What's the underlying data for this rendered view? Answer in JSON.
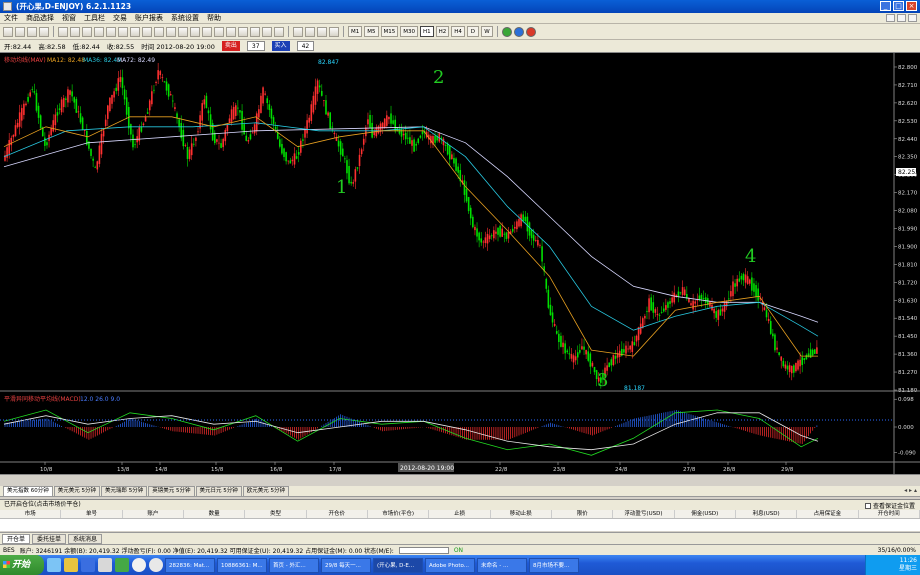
{
  "window": {
    "title": "(开心果,D-ENJOY) 6.2.1.1123"
  },
  "menu": [
    "文件",
    "商品选择",
    "视窗",
    "工具栏",
    "交易",
    "账户报表",
    "系统设置",
    "帮助"
  ],
  "toolbar": {
    "timeframes": [
      "M1",
      "M5",
      "M15",
      "M30",
      "H1",
      "H2",
      "H4",
      "D",
      "W"
    ],
    "active_timeframe": "H1"
  },
  "quote": {
    "open": "开:82.44",
    "high": "高:82.58",
    "low": "低:82.44",
    "close": "收:82.55",
    "time": "时间 2012-08-20 19:00",
    "sell_label": "卖出",
    "sell_price": "37",
    "buy_label": "买入",
    "buy_price": "42"
  },
  "chart_data": {
    "type": "candlestick",
    "legend": {
      "prefix": "移动均线(MAV)",
      "ma12": "MA12: 82.48",
      "ma36": "MA36: 82.49",
      "ma72": "MA72: 82.49"
    },
    "y_ticks": [
      "82.800",
      "82.710",
      "82.620",
      "82.530",
      "82.440",
      "82.350",
      "82.260",
      "82.170",
      "82.080",
      "81.990",
      "81.900",
      "81.810",
      "81.720",
      "81.630",
      "81.540",
      "81.450",
      "81.360",
      "81.270",
      "81.180"
    ],
    "ylim": [
      81.18,
      82.82
    ],
    "current_price": "82.253",
    "high_label": "82.847",
    "low_label": "81.187",
    "x_ticks": [
      "10/8",
      "13/8",
      "14/8",
      "15/8",
      "16/8",
      "17/8",
      "22/8",
      "23/8",
      "24/8",
      "27/8",
      "28/8",
      "29/8"
    ],
    "x_cursor_label": "2012-08-20 19:00",
    "annotations": [
      "1",
      "2",
      "3",
      "4"
    ],
    "path_points": [
      [
        0,
        82.33
      ],
      [
        8,
        82.55
      ],
      [
        14,
        82.7
      ],
      [
        20,
        82.4
      ],
      [
        26,
        82.58
      ],
      [
        32,
        82.68
      ],
      [
        38,
        82.5
      ],
      [
        44,
        82.28
      ],
      [
        50,
        82.6
      ],
      [
        56,
        82.75
      ],
      [
        62,
        82.4
      ],
      [
        68,
        82.55
      ],
      [
        74,
        82.78
      ],
      [
        80,
        82.65
      ],
      [
        84,
        82.5
      ],
      [
        88,
        82.35
      ],
      [
        92,
        82.45
      ],
      [
        96,
        82.65
      ],
      [
        100,
        82.45
      ],
      [
        104,
        82.4
      ],
      [
        108,
        82.55
      ],
      [
        112,
        82.6
      ],
      [
        116,
        82.42
      ],
      [
        120,
        82.5
      ],
      [
        124,
        82.68
      ],
      [
        128,
        82.55
      ],
      [
        132,
        82.4
      ],
      [
        136,
        82.32
      ],
      [
        140,
        82.35
      ],
      [
        146,
        82.55
      ],
      [
        150,
        82.72
      ],
      [
        154,
        82.58
      ],
      [
        158,
        82.45
      ],
      [
        162,
        82.36
      ],
      [
        166,
        82.2
      ],
      [
        170,
        82.35
      ],
      [
        172,
        82.45
      ],
      [
        174,
        82.55
      ],
      [
        176,
        82.46
      ],
      [
        180,
        82.5
      ],
      [
        184,
        82.55
      ],
      [
        188,
        82.48
      ],
      [
        192,
        82.45
      ],
      [
        196,
        82.4
      ],
      [
        200,
        82.48
      ],
      [
        204,
        82.43
      ],
      [
        208,
        82.45
      ],
      [
        212,
        82.38
      ],
      [
        216,
        82.3
      ],
      [
        220,
        82.18
      ],
      [
        224,
        82.0
      ],
      [
        228,
        81.92
      ],
      [
        232,
        81.95
      ],
      [
        236,
        81.98
      ],
      [
        240,
        81.95
      ],
      [
        244,
        82.0
      ],
      [
        248,
        82.05
      ],
      [
        252,
        81.95
      ],
      [
        256,
        81.9
      ],
      [
        260,
        81.6
      ],
      [
        264,
        81.45
      ],
      [
        268,
        81.38
      ],
      [
        272,
        81.33
      ],
      [
        276,
        81.4
      ],
      [
        280,
        81.32
      ],
      [
        284,
        81.22
      ],
      [
        288,
        81.3
      ],
      [
        292,
        81.35
      ],
      [
        296,
        81.38
      ],
      [
        300,
        81.4
      ],
      [
        304,
        81.5
      ],
      [
        308,
        81.62
      ],
      [
        312,
        81.55
      ],
      [
        316,
        81.6
      ],
      [
        320,
        81.65
      ],
      [
        324,
        81.68
      ],
      [
        328,
        81.6
      ],
      [
        332,
        81.65
      ],
      [
        336,
        81.62
      ],
      [
        340,
        81.55
      ],
      [
        344,
        81.6
      ],
      [
        348,
        81.7
      ],
      [
        352,
        81.75
      ],
      [
        356,
        81.72
      ],
      [
        360,
        81.65
      ],
      [
        364,
        81.55
      ],
      [
        368,
        81.4
      ],
      [
        372,
        81.3
      ],
      [
        376,
        81.28
      ],
      [
        380,
        81.32
      ],
      [
        384,
        81.36
      ],
      [
        388,
        81.38
      ]
    ],
    "ma12_points": [
      [
        0,
        82.4
      ],
      [
        20,
        82.5
      ],
      [
        40,
        82.45
      ],
      [
        60,
        82.55
      ],
      [
        80,
        82.55
      ],
      [
        100,
        82.5
      ],
      [
        120,
        82.55
      ],
      [
        140,
        82.4
      ],
      [
        160,
        82.45
      ],
      [
        180,
        82.48
      ],
      [
        200,
        82.48
      ],
      [
        220,
        82.2
      ],
      [
        240,
        81.98
      ],
      [
        260,
        81.75
      ],
      [
        280,
        81.38
      ],
      [
        300,
        81.35
      ],
      [
        320,
        81.58
      ],
      [
        340,
        81.62
      ],
      [
        360,
        81.65
      ],
      [
        380,
        81.35
      ],
      [
        388,
        81.35
      ]
    ],
    "ma36_points": [
      [
        0,
        82.35
      ],
      [
        30,
        82.48
      ],
      [
        60,
        82.5
      ],
      [
        90,
        82.5
      ],
      [
        120,
        82.52
      ],
      [
        150,
        82.48
      ],
      [
        180,
        82.48
      ],
      [
        200,
        82.5
      ],
      [
        220,
        82.35
      ],
      [
        240,
        82.1
      ],
      [
        260,
        81.9
      ],
      [
        280,
        81.6
      ],
      [
        300,
        81.48
      ],
      [
        320,
        81.55
      ],
      [
        340,
        81.6
      ],
      [
        360,
        81.62
      ],
      [
        380,
        81.5
      ],
      [
        388,
        81.45
      ]
    ],
    "ma72_points": [
      [
        0,
        82.3
      ],
      [
        40,
        82.42
      ],
      [
        80,
        82.45
      ],
      [
        120,
        82.48
      ],
      [
        160,
        82.49
      ],
      [
        200,
        82.5
      ],
      [
        220,
        82.42
      ],
      [
        240,
        82.25
      ],
      [
        260,
        82.05
      ],
      [
        280,
        81.85
      ],
      [
        300,
        81.7
      ],
      [
        320,
        81.65
      ],
      [
        340,
        81.62
      ],
      [
        360,
        81.62
      ],
      [
        380,
        81.55
      ],
      [
        388,
        81.52
      ]
    ],
    "indicator": {
      "label": "平滑异同移动平均线(MACD)",
      "values_text": "12.0  26.0  9.0",
      "y_ticks": [
        "0.098",
        "0.000",
        "-0.090"
      ],
      "ylim": [
        -0.12,
        0.12
      ],
      "macd_points": [
        [
          0,
          0.02
        ],
        [
          20,
          0.06
        ],
        [
          40,
          -0.02
        ],
        [
          60,
          0.05
        ],
        [
          80,
          0.03
        ],
        [
          100,
          -0.01
        ],
        [
          120,
          0.04
        ],
        [
          140,
          -0.05
        ],
        [
          160,
          0.03
        ],
        [
          180,
          0.01
        ],
        [
          200,
          0.02
        ],
        [
          220,
          -0.04
        ],
        [
          240,
          -0.08
        ],
        [
          260,
          -0.06
        ],
        [
          280,
          -0.1
        ],
        [
          300,
          -0.04
        ],
        [
          320,
          0.05
        ],
        [
          340,
          0.06
        ],
        [
          360,
          0.03
        ],
        [
          380,
          -0.07
        ],
        [
          388,
          -0.04
        ]
      ],
      "signal_points": [
        [
          0,
          0.01
        ],
        [
          20,
          0.04
        ],
        [
          40,
          0.01
        ],
        [
          60,
          0.03
        ],
        [
          80,
          0.04
        ],
        [
          100,
          0.01
        ],
        [
          120,
          0.02
        ],
        [
          140,
          -0.02
        ],
        [
          160,
          0.0
        ],
        [
          180,
          0.02
        ],
        [
          200,
          0.02
        ],
        [
          220,
          -0.01
        ],
        [
          240,
          -0.05
        ],
        [
          260,
          -0.07
        ],
        [
          280,
          -0.08
        ],
        [
          300,
          -0.06
        ],
        [
          320,
          0.01
        ],
        [
          340,
          0.05
        ],
        [
          360,
          0.05
        ],
        [
          380,
          -0.03
        ],
        [
          388,
          -0.05
        ]
      ]
    }
  },
  "chart_tabs": [
    "美元指数 60分钟",
    "美元美元 5分钟",
    "美元瑞郎 5分钟",
    "英镑美元 5分钟",
    "美元日元 5分钟",
    "欧元美元 5分钟"
  ],
  "tab_nav": "◂ ▸ ▴",
  "positions": {
    "title": "已开启仓位(点击市场价平仓)",
    "check_label": "查看保证金位置",
    "columns": [
      "市场",
      "单号",
      "账户",
      "数量",
      "类型",
      "开仓价",
      "市场价(平仓)",
      "止损",
      "移动止损",
      "限价",
      "浮动盈亏(USD)",
      "佣金(USD)",
      "利息(USD)",
      "占用保证金",
      "开仓时间"
    ]
  },
  "bottom_tabs": [
    "开仓单",
    "委托挂单",
    "系统消息"
  ],
  "status": {
    "label": "BES",
    "account": "账户: 3246191 余额(B): 20,419.32 浮动盈亏(F): 0.00 净值(E): 20,419.32 可用保证金(U): 20,419.32 占用保证金(M): 0.00 状态(M/E):",
    "ok": "ON",
    "right": "35/16/0.00%"
  },
  "taskbar": {
    "start": "开始",
    "tasks": [
      "282836: Mat...",
      "10886361: M...",
      "首页 - 外汇...",
      "29/8 每天一...",
      "(开心果, D-E...",
      "Adobe Photo...",
      "未命名 - ...",
      "8月市场不要..."
    ],
    "active_task": 4,
    "clock": "11:26",
    "day": "星期三"
  }
}
